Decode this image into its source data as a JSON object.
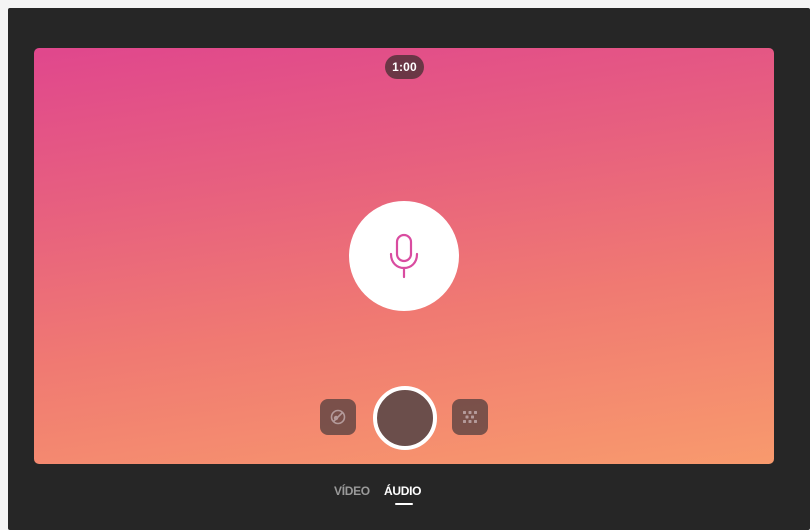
{
  "recorder": {
    "timer": "1:00",
    "mic_icon": "microphone-icon",
    "left_control_icon": "circle-slash-icon",
    "right_control_icon": "grid-effects-icon",
    "record_button_color": "#6b4e4b"
  },
  "tabs": [
    {
      "label": "VÍDEO",
      "active": false
    },
    {
      "label": "ÁUDIO",
      "active": true
    }
  ],
  "colors": {
    "gradient_top": "#e0478d",
    "gradient_bottom": "#f89a6d",
    "frame_background": "#262626",
    "mic_accent": "#d94ca0"
  }
}
